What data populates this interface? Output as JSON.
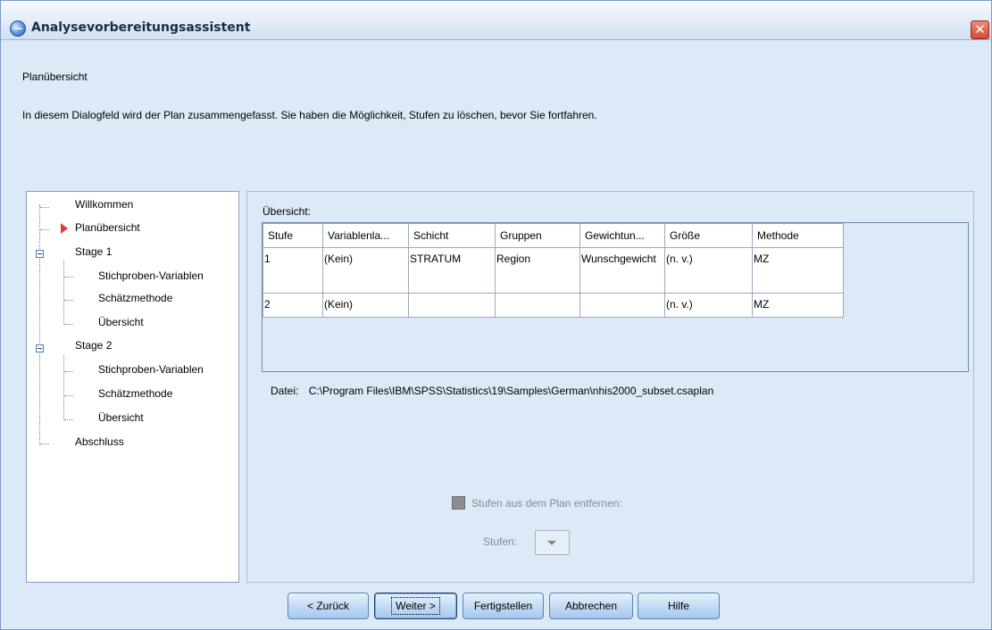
{
  "window": {
    "title": "Analysevorbereitungsassistent",
    "close_symbol": "✕",
    "icon": "spss-globe-icon"
  },
  "heading": "Planübersicht",
  "description": "In diesem Dialogfeld wird der Plan zusammengefasst. Sie haben die Möglichkeit, Stufen zu löschen, bevor Sie fortfahren.",
  "tree": {
    "items": [
      {
        "label": "Willkommen"
      },
      {
        "label": "Planübersicht",
        "selected": true
      },
      {
        "label": "Stage 1",
        "expanded": true
      },
      {
        "label": "Stichproben-Variablen"
      },
      {
        "label": "Schätzmethode"
      },
      {
        "label": "Übersicht"
      },
      {
        "label": "Stage 2",
        "expanded": true
      },
      {
        "label": "Stichproben-Variablen"
      },
      {
        "label": "Schätzmethode"
      },
      {
        "label": "Übersicht"
      },
      {
        "label": "Abschluss"
      }
    ]
  },
  "overview": {
    "label": "Übersicht:",
    "columns": [
      "Stufe",
      "Variablenla...",
      "Schicht",
      "Gruppen",
      "Gewichtun...",
      "Größe",
      "Methode"
    ],
    "rows": [
      [
        "1",
        "(Kein)",
        "STRATUM",
        "Region",
        "Wunschgewicht",
        "(n. v.)",
        "MZ"
      ],
      [
        "2",
        "(Kein)",
        "",
        "",
        "",
        "(n. v.)",
        "MZ"
      ]
    ]
  },
  "file": {
    "label": "Datei:",
    "path": "C:\\Program Files\\IBM\\SPSS\\Statistics\\19\\Samples\\German\\nhis2000_subset.csaplan"
  },
  "remove": {
    "checkbox_label": "Stufen aus dem Plan entfernen:",
    "stages_label": "Stufen:"
  },
  "buttons": {
    "back": "< Zurück",
    "next": "Weiter >",
    "finish": "Fertigstellen",
    "cancel": "Abbrechen",
    "help": "Hilfe"
  }
}
